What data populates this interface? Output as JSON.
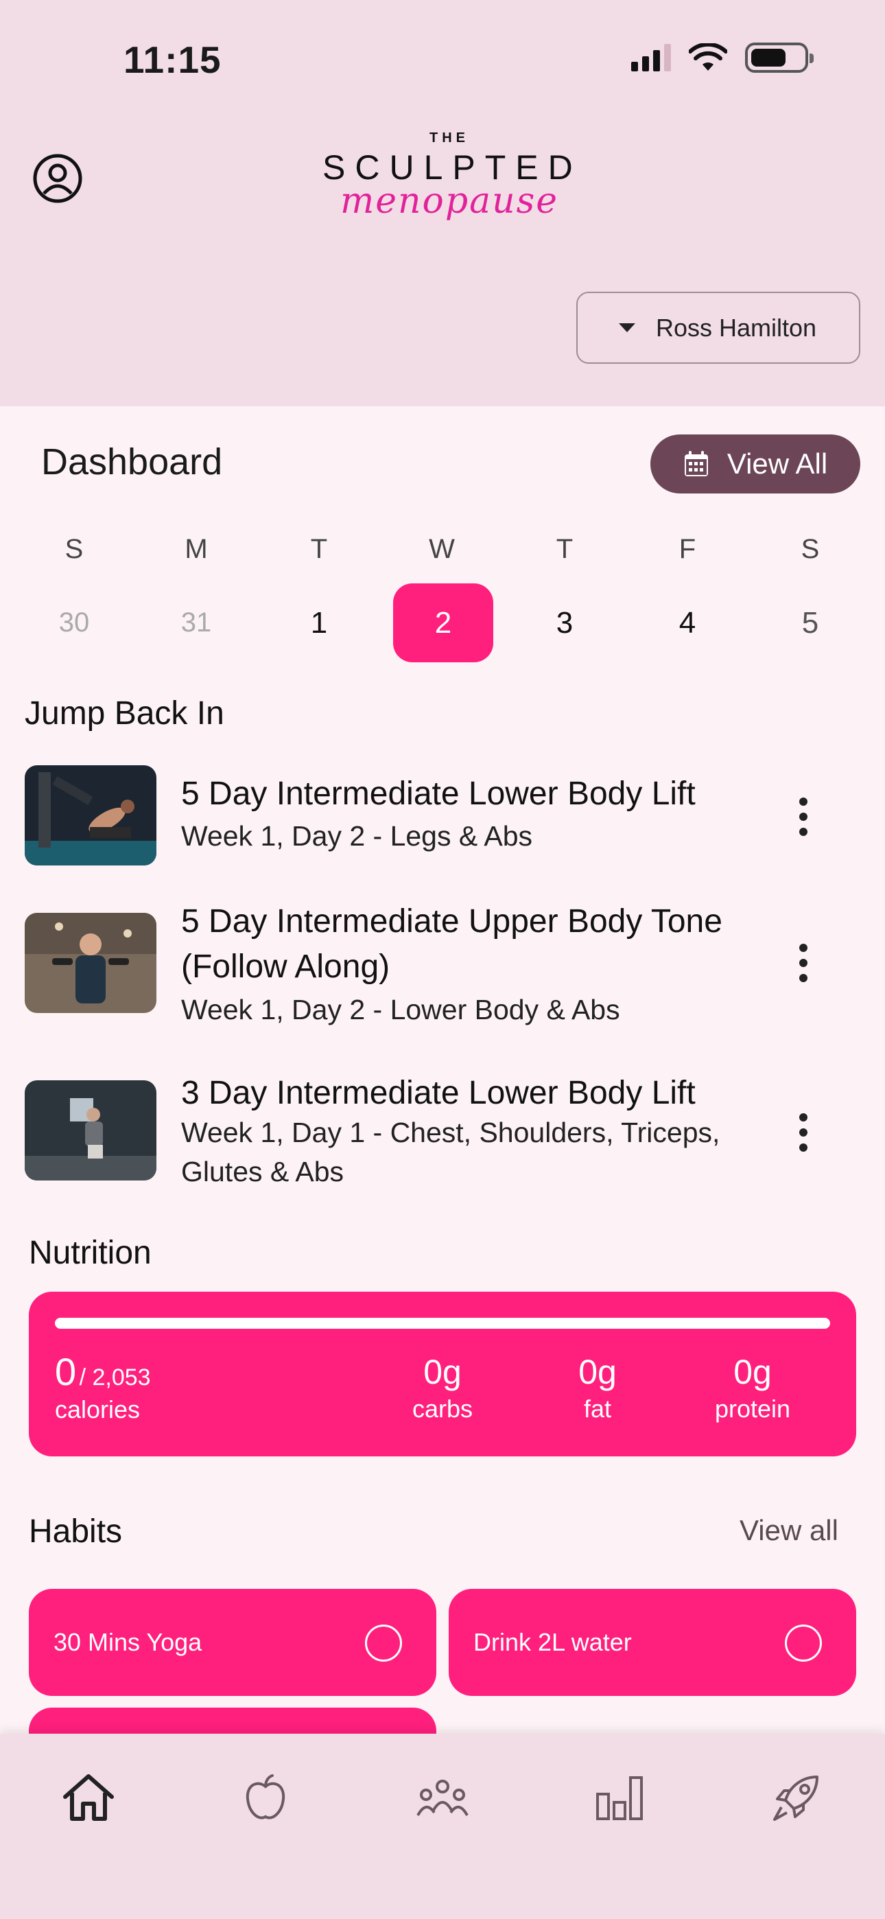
{
  "status": {
    "time": "11:15"
  },
  "header": {
    "logo_the": "THE",
    "logo_sculpted": "SCULPTED",
    "logo_menopause": "menopause",
    "user_name": "Ross Hamilton"
  },
  "dashboard": {
    "title": "Dashboard",
    "view_all": "View All",
    "days": [
      {
        "letter": "S",
        "num": "30",
        "state": "past"
      },
      {
        "letter": "M",
        "num": "31",
        "state": "past"
      },
      {
        "letter": "T",
        "num": "1",
        "state": "normal"
      },
      {
        "letter": "W",
        "num": "2",
        "state": "selected"
      },
      {
        "letter": "T",
        "num": "3",
        "state": "normal"
      },
      {
        "letter": "F",
        "num": "4",
        "state": "normal"
      },
      {
        "letter": "S",
        "num": "5",
        "state": "dim"
      }
    ]
  },
  "jump_back_in": {
    "title": "Jump Back In",
    "items": [
      {
        "title": "5 Day Intermediate Lower Body Lift",
        "subtitle": "Week 1, Day 2 - Legs & Abs"
      },
      {
        "title": "5 Day Intermediate  Upper Body Tone  (Follow Along)",
        "subtitle": "Week 1, Day 2 - Lower Body & Abs"
      },
      {
        "title": "3 Day Intermediate Lower Body Lift",
        "subtitle": "Week 1, Day 1 -  Chest, Shoulders, Triceps, Glutes & Abs"
      }
    ]
  },
  "nutrition": {
    "title": "Nutrition",
    "calories_value": "0",
    "calories_goal": "/ 2,053",
    "calories_label": "calories",
    "calories_progress": 0,
    "macros": [
      {
        "value": "0g",
        "label": "carbs"
      },
      {
        "value": "0g",
        "label": "fat"
      },
      {
        "value": "0g",
        "label": "protein"
      }
    ]
  },
  "habits": {
    "title": "Habits",
    "view_all": "View all",
    "items": [
      {
        "label": "30 Mins Yoga",
        "done": false
      },
      {
        "label": "Drink 2L water",
        "done": false
      }
    ]
  },
  "tabbar": {
    "icons": [
      "home-icon",
      "apple-icon",
      "community-icon",
      "stats-icon",
      "rocket-icon"
    ],
    "active": "home-icon"
  },
  "colors": {
    "accent": "#ff1f7d",
    "header_bg": "#f2dde7",
    "button_dark": "#6c4556",
    "page_bg": "#fdf3f6"
  }
}
